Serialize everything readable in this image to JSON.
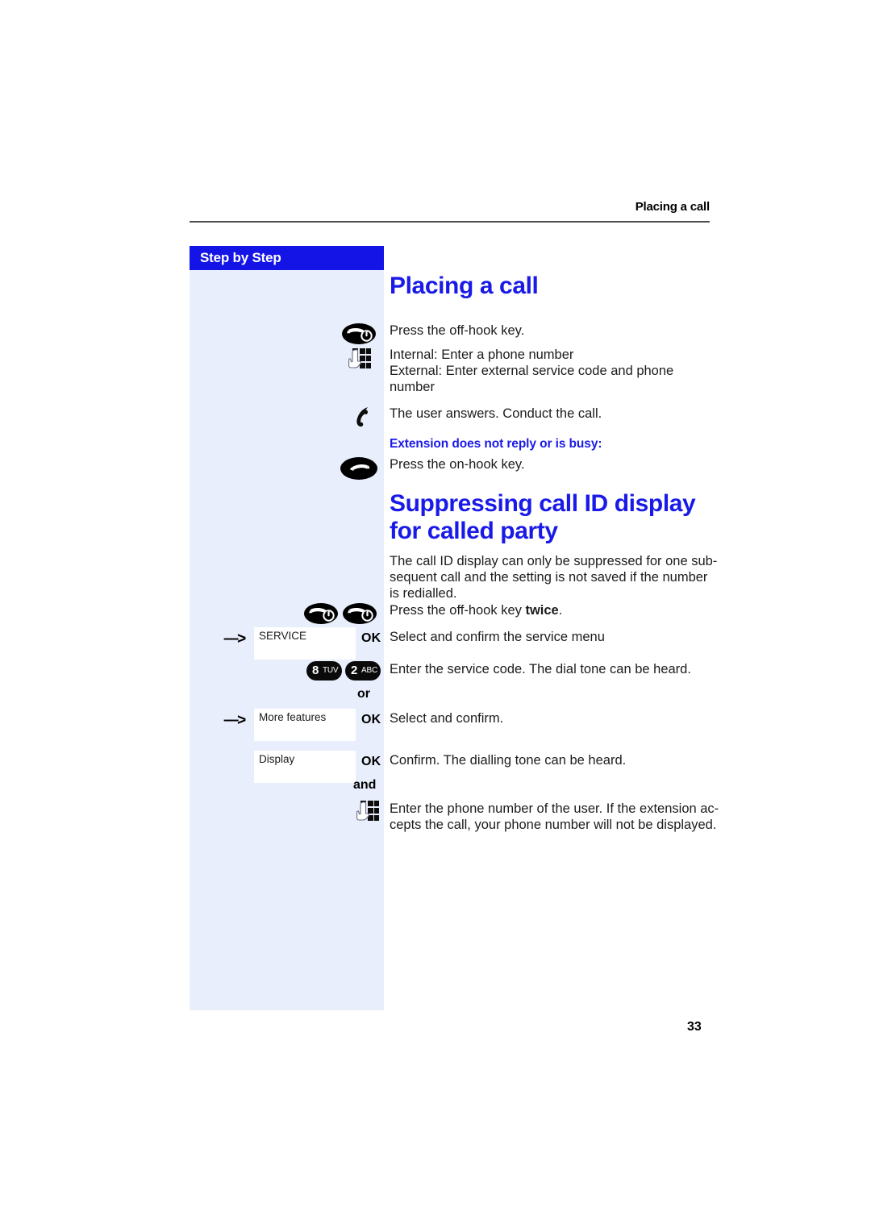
{
  "page": {
    "running_header": "Placing a call",
    "page_number": "33",
    "sidebar_title": "Step by Step",
    "colors": {
      "brand_blue": "#1414e6",
      "heading_blue": "#1a1ae8",
      "sidebar_bg": "#e8eefb",
      "text": "#1c1c1c",
      "rule": "#4d4d4d"
    }
  },
  "sections": [
    {
      "heading": "Placing a call",
      "steps": [
        {
          "icon": "off-hook-key-icon",
          "lines": [
            "Press the off-hook key."
          ]
        },
        {
          "icon": "keypad-hand-icon",
          "lines": [
            "Internal: Enter a phone number",
            "External: Enter external service code and phone",
            "number"
          ]
        },
        {
          "icon": "handset-icon",
          "lines": [
            "The user answers. Conduct the call."
          ]
        }
      ],
      "subheading": "Extension does not reply or is busy:",
      "steps_after": [
        {
          "icon": "on-hook-key-icon",
          "lines": [
            "Press the on-hook key."
          ]
        }
      ]
    },
    {
      "heading": "Suppressing call ID display for called party",
      "intro": [
        "The call ID display can only be suppressed for one sub-",
        "sequent call and the setting is not saved if the number",
        "is redialled."
      ],
      "steps": [
        {
          "icon": "off-hook-key-icon-twice",
          "text_prefix": "Press the off-hook key ",
          "text_bold": "twice",
          "text_suffix": "."
        },
        {
          "icon": "arrow-dashed-icon",
          "display_label": "SERVICE",
          "ok_label": "OK",
          "text": "Select and confirm the service menu"
        },
        {
          "keys": [
            {
              "digit": "8",
              "letters": "TUV"
            },
            {
              "digit": "2",
              "letters": "ABC"
            }
          ],
          "text": "Enter the service code. The dial tone can be heard."
        },
        {
          "conjunction": "or"
        },
        {
          "icon": "arrow-dashed-icon",
          "display_label": "More features",
          "ok_label": "OK",
          "text": "Select and confirm."
        },
        {
          "display_label": "Display",
          "ok_label": "OK",
          "text": "Confirm. The dialling tone can be heard."
        },
        {
          "conjunction": "and"
        },
        {
          "icon": "keypad-hand-icon",
          "lines": [
            "Enter the phone number of the user. If the extension ac-",
            "cepts the call, your phone number will not be displayed."
          ]
        }
      ]
    }
  ]
}
